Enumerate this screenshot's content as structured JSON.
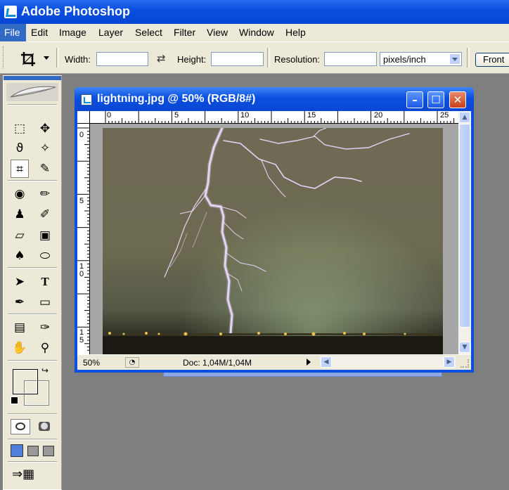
{
  "app": {
    "title": "Adobe Photoshop"
  },
  "menu": [
    "File",
    "Edit",
    "Image",
    "Layer",
    "Select",
    "Filter",
    "View",
    "Window",
    "Help"
  ],
  "options": {
    "width_label": "Width:",
    "height_label": "Height:",
    "resolution_label": "Resolution:",
    "units_value": "pixels/inch",
    "front_button": "Front"
  },
  "document": {
    "title": "lightning.jpg @ 50% (RGB/8#)",
    "ruler_h": [
      "0",
      "5",
      "10",
      "15",
      "20",
      "25"
    ],
    "ruler_v": [
      "0",
      "5",
      "1\n0",
      "1\n5"
    ],
    "status": {
      "zoom": "50%",
      "doc_size": "Doc: 1,04M/1,04M"
    }
  },
  "colors": {
    "foreground": "#000000",
    "background": "#d6d3c6",
    "titlebar": "#0a4fe0",
    "menu_highlight": "#316ac5",
    "lightning": "#d9c8ef"
  },
  "icons": {
    "crop": "crop-icon",
    "swap": "swap-icon",
    "dropdown": "chevron-down-icon"
  }
}
